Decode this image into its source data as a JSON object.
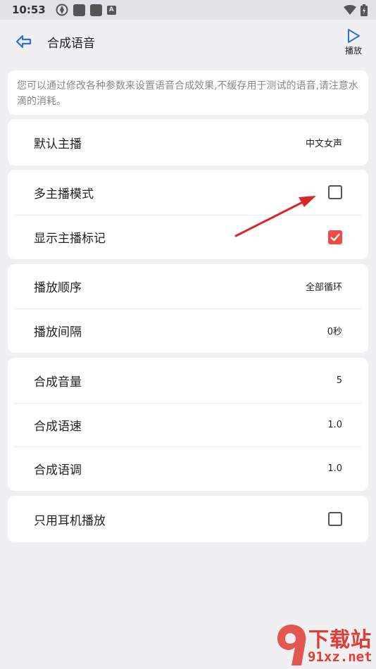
{
  "status_bar": {
    "time": "10:53"
  },
  "header": {
    "title": "合成语音",
    "play_label": "播放"
  },
  "notice": "您可以通过修改各种参数来设置语音合成效果,不缓存用于测试的语音,请注意水滴的消耗。",
  "group1": {
    "default_anchor": {
      "label": "默认主播",
      "value": "中文女声"
    }
  },
  "group2": {
    "multi_anchor": {
      "label": "多主播模式",
      "checked": false
    },
    "show_anchor_tag": {
      "label": "显示主播标记",
      "checked": true
    }
  },
  "group3": {
    "play_order": {
      "label": "播放顺序",
      "value": "全部循环"
    },
    "play_interval": {
      "label": "播放间隔",
      "value": "0秒"
    }
  },
  "group4": {
    "volume": {
      "label": "合成音量",
      "value": "5"
    },
    "speed": {
      "label": "合成语速",
      "value": "1.0"
    },
    "pitch": {
      "label": "合成语调",
      "value": "1.0"
    }
  },
  "group5": {
    "headphone_only": {
      "label": "只用耳机播放",
      "checked": false
    }
  },
  "watermark": {
    "text": "下载站",
    "url": "91xz.net"
  },
  "colors": {
    "accent": "#2f6fe0",
    "checked": "#f04b46",
    "annotation_arrow": "#d9262b"
  }
}
